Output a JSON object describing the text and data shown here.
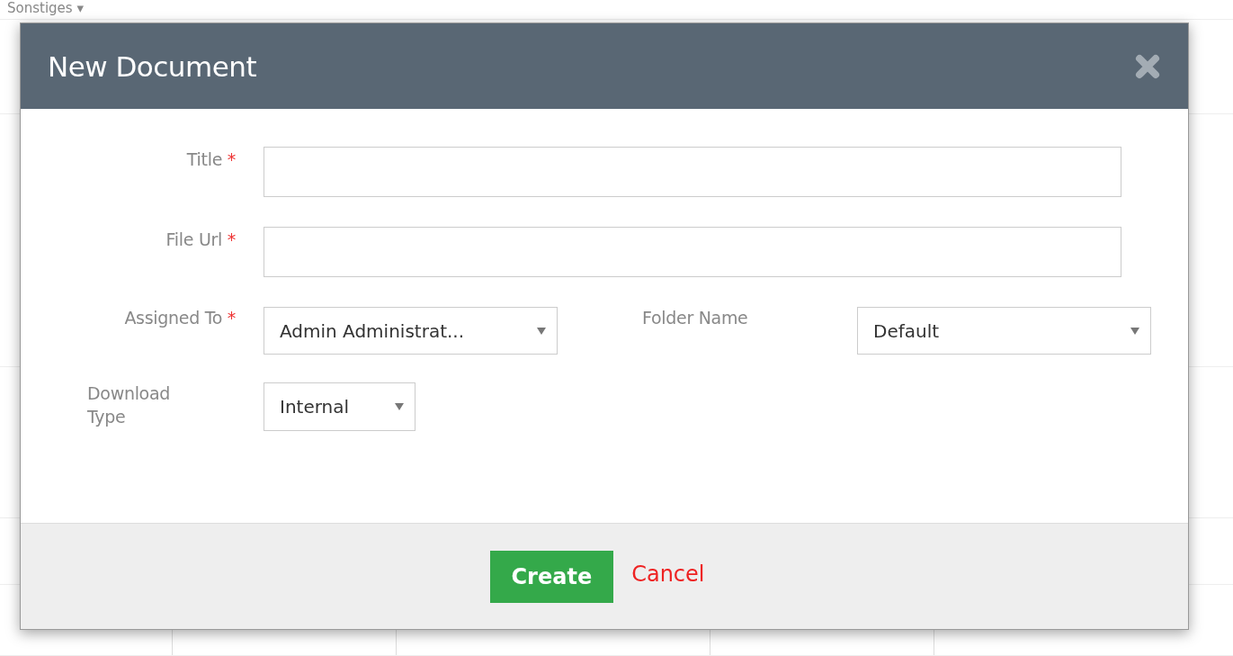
{
  "background": {
    "menu": {
      "label": "Sonstiges",
      "caret": "▾"
    }
  },
  "dialog": {
    "title": "New Document",
    "fields": [
      {
        "kind": "text",
        "label": "Title",
        "required": true
      },
      {
        "kind": "text",
        "label": "File Url",
        "required": true
      }
    ],
    "selects": [
      {
        "label": "Assigned To",
        "required": true,
        "value": "Admin Administrat..."
      },
      {
        "label": "Folder Name",
        "required": false,
        "value": "Default"
      },
      {
        "label": "Download Type",
        "required": false,
        "value": "Internal"
      }
    ],
    "required_mark": "*",
    "buttons": [
      {
        "kind": "primary",
        "label": "Create"
      },
      {
        "kind": "link",
        "label": "Cancel"
      }
    ]
  }
}
